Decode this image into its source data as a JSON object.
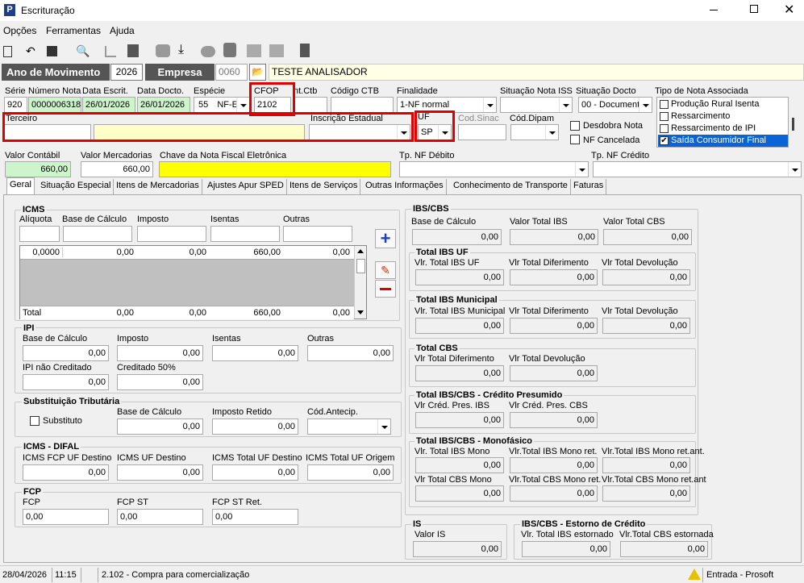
{
  "window": {
    "title": "Escrituração",
    "app_letter": "P"
  },
  "menu": [
    "Opções",
    "Ferramentas",
    "Ajuda"
  ],
  "header": {
    "ano_label": "Ano de Movimento",
    "ano": "2026",
    "empresa_label": "Empresa",
    "empresa_codigo": "0060",
    "empresa_nome": "TESTE ANALISADOR"
  },
  "nota": {
    "serie_label": "Série",
    "serie": "920",
    "numero_label": "Número Nota",
    "numero": "0000006318",
    "data_escrit_label": "Data Escrit.",
    "data_escrit": "26/01/2026",
    "data_docto_label": "Data Docto.",
    "data_docto": "26/01/2026",
    "especie_label": "Espécie",
    "especie_cod": "55",
    "especie": "NF-E",
    "cfop_label": "CFOP",
    "cfop": "2102",
    "contctb_label": "nt.Ctb",
    "codigo_ctb_label": "Código CTB",
    "finalidade_label": "Finalidade",
    "finalidade": "1-NF normal",
    "sit_iss_label": "Situação Nota ISS",
    "sit_docto_label": "Situação Docto",
    "sit_docto": "00 - Document",
    "tipo_nota_label": "Tipo de Nota Associada",
    "tipo_nota_items": [
      "Produção Rural Isenta",
      "Ressarcimento",
      "Ressarcimento de IPI",
      "Saída Consumidor Final"
    ],
    "terceiro_label": "Terceiro",
    "inscricao_label": "Inscrição Estadual",
    "uf_label": "UF",
    "uf": "SP",
    "cod_sinac_label": "Cod.Sinac",
    "cod_dipam_label": "Cód.Dipam",
    "desdobra_label": "Desdobra Nota",
    "nf_cancelada_label": "NF Cancelada",
    "valor_contabil_label": "Valor Contábil",
    "valor_contabil": "660,00",
    "valor_merc_label": "Valor Mercadorias",
    "valor_merc": "660,00",
    "chave_label": "Chave da Nota Fiscal Eletrônica",
    "tp_debito_label": "Tp. NF Débito",
    "tp_credito_label": "Tp. NF Crédito"
  },
  "tabs": [
    "Geral",
    "Situação Especial",
    "Itens de Mercadorias",
    "Ajustes Apur SPED",
    "Itens de Serviços",
    "Outras Informações",
    "Conhecimento de Transporte",
    "Faturas"
  ],
  "icms": {
    "title": "ICMS",
    "cols": [
      "Alíquota",
      "Base de Cálculo",
      "Imposto",
      "Isentas",
      "Outras"
    ],
    "row": [
      "0,0000",
      "0,00",
      "0,00",
      "660,00",
      "0,00"
    ],
    "total": [
      "Total",
      "0,00",
      "0,00",
      "660,00",
      "0,00"
    ]
  },
  "ipi": {
    "title": "IPI",
    "base_label": "Base de Cálculo",
    "base": "0,00",
    "imposto_label": "Imposto",
    "imposto": "0,00",
    "isentas_label": "Isentas",
    "isentas": "0,00",
    "outras_label": "Outras",
    "outras": "0,00",
    "nao_cred_label": "IPI não Creditado",
    "nao_cred": "0,00",
    "cred50_label": "Creditado 50%",
    "cred50": "0,00"
  },
  "st": {
    "title": "Substituição Tributária",
    "substituto_label": "Substituto",
    "base_label": "Base de Cálculo",
    "base": "0,00",
    "retido_label": "Imposto Retido",
    "retido": "0,00",
    "antecip_label": "Cód.Antecip."
  },
  "difal": {
    "title": "ICMS - DIFAL",
    "fcp_label": "ICMS FCP UF Destino",
    "fcp": "0,00",
    "uf_dest_label": "ICMS UF Destino",
    "uf_dest": "0,00",
    "total_dest_label": "ICMS Total UF Destino",
    "total_dest": "0,00",
    "total_orig_label": "ICMS Total UF Origem",
    "total_orig": "0,00"
  },
  "fcp": {
    "title": "FCP",
    "fcp_label": "FCP",
    "fcp": "0,00",
    "st_label": "FCP ST",
    "st": "0,00",
    "st_ret_label": "FCP ST Ret.",
    "st_ret": "0,00"
  },
  "ibscbs": {
    "title": "IBS/CBS",
    "base_label": "Base de Cálculo",
    "base": "0,00",
    "ibs_label": "Valor Total IBS",
    "ibs": "0,00",
    "cbs_label": "Valor Total CBS",
    "cbs": "0,00"
  },
  "ibs_uf": {
    "title": "Total IBS UF",
    "a_label": "Vlr. Total IBS UF",
    "a": "0,00",
    "b_label": "Vlr Total Diferimento",
    "b": "0,00",
    "c_label": "Vlr Total Devolução",
    "c": "0,00"
  },
  "ibs_mun": {
    "title": "Total IBS Municipal",
    "a_label": "Vlr. Total IBS Municipal",
    "a": "0,00",
    "b_label": "Vlr Total Diferimento",
    "b": "0,00",
    "c_label": "Vlr Total Devolução",
    "c": "0,00"
  },
  "cbs": {
    "title": "Total CBS",
    "a_label": "Vlr Total Diferimento",
    "a": "0,00",
    "b_label": "Vlr Total Devolução",
    "b": "0,00"
  },
  "presumido": {
    "title": "Total IBS/CBS - Crédito Presumido",
    "a_label": "Vlr Créd. Pres. IBS",
    "a": "0,00",
    "b_label": "Vlr Créd. Pres. CBS",
    "b": "0,00"
  },
  "monofasico": {
    "title": "Total IBS/CBS - Monofásico",
    "a_label": "Vlr. Total IBS Mono",
    "a": "0,00",
    "b_label": "Vlr.Total IBS Mono ret.",
    "b": "0,00",
    "c_label": "Vlr.Total IBS Mono ret.ant.",
    "c": "0,00",
    "d_label": "Vlr Total CBS Mono",
    "d": "0,00",
    "e_label": "Vlr.Total CBS Mono ret.",
    "e": "0,00",
    "f_label": "Vlr.Total CBS Mono ret.ant",
    "f": "0,00"
  },
  "is": {
    "title": "IS",
    "label": "Valor IS",
    "value": "0,00"
  },
  "estorno": {
    "title": "IBS/CBS - Estorno de Crédito",
    "a_label": "Vlr. Total IBS estornado",
    "a": "0,00",
    "b_label": "Vlr.Total CBS estornada",
    "b": "0,00"
  },
  "status": {
    "date": "28/04/2026",
    "time": "11:15",
    "message": "2.102 - Compra para comercialização",
    "right": "Entrada - Prosoft"
  },
  "colors": {
    "highlight_green": "#ccf5cc",
    "highlight_yellow": "#ffffc8",
    "chave_yellow": "#ffff00",
    "red_box": "#e00000",
    "select_blue": "#0a64d6"
  }
}
